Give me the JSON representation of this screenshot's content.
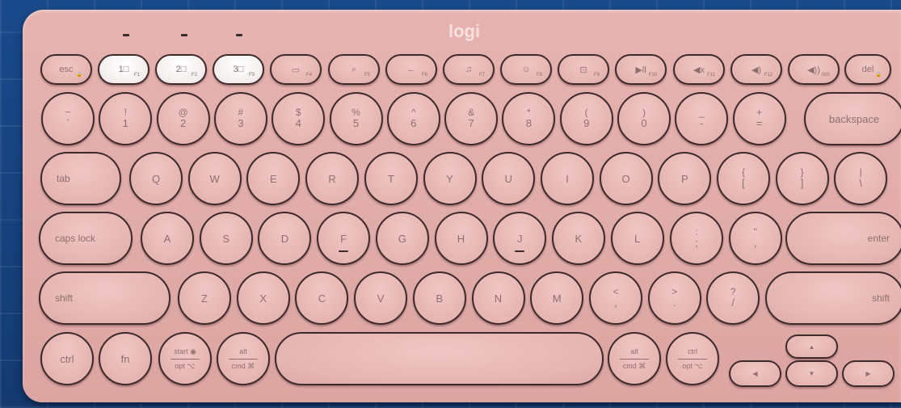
{
  "brand": "logi",
  "colors": {
    "keyboard_body": "#e2aeab",
    "key_face": "#ecbdb9",
    "key_border": "#3d2a2b",
    "background": "#17407a"
  },
  "fn_row": [
    {
      "name": "esc-key",
      "label": "esc",
      "sub": "🔒",
      "light": false
    },
    {
      "name": "channel-1-key",
      "label": "1□",
      "sub": "F1",
      "light": true
    },
    {
      "name": "channel-2-key",
      "label": "2□",
      "sub": "F2",
      "light": true
    },
    {
      "name": "channel-3-key",
      "label": "3□",
      "sub": "F3",
      "light": true
    },
    {
      "name": "app-switch-key",
      "label": "▭",
      "sub": "F4",
      "light": false
    },
    {
      "name": "search-key",
      "label": "⌕",
      "sub": "F5",
      "light": false
    },
    {
      "name": "back-key",
      "label": "←",
      "sub": "F6",
      "light": false
    },
    {
      "name": "dictation-key",
      "label": "♫",
      "sub": "F7",
      "light": false
    },
    {
      "name": "emoji-key",
      "label": "☺",
      "sub": "F8",
      "light": false
    },
    {
      "name": "screenshot-key",
      "label": "⊡",
      "sub": "F9",
      "light": false
    },
    {
      "name": "play-pause-key",
      "label": "▶ll",
      "sub": "F10",
      "light": false
    },
    {
      "name": "mute-key",
      "label": "◀x",
      "sub": "F11",
      "light": false
    },
    {
      "name": "volume-down-key",
      "label": "◀)",
      "sub": "F12",
      "light": false
    },
    {
      "name": "volume-up-key",
      "label": "◀))",
      "sub": "INS",
      "light": false
    },
    {
      "name": "del-key",
      "label": "del",
      "sub": "🔒",
      "light": false
    }
  ],
  "num_row": [
    {
      "top": "~",
      "bottom": "`"
    },
    {
      "top": "!",
      "bottom": "1"
    },
    {
      "top": "@",
      "bottom": "2"
    },
    {
      "top": "#",
      "bottom": "3"
    },
    {
      "top": "$",
      "bottom": "4"
    },
    {
      "top": "%",
      "bottom": "5"
    },
    {
      "top": "^",
      "bottom": "6"
    },
    {
      "top": "&",
      "bottom": "7"
    },
    {
      "top": "*",
      "bottom": "8"
    },
    {
      "top": "(",
      "bottom": "9"
    },
    {
      "top": ")",
      "bottom": "0"
    },
    {
      "top": "_",
      "bottom": "-"
    },
    {
      "top": "+",
      "bottom": "="
    }
  ],
  "backspace": "backspace",
  "tab": "tab",
  "q_row": [
    "Q",
    "W",
    "E",
    "R",
    "T",
    "Y",
    "U",
    "I",
    "O",
    "P"
  ],
  "q_row_extra": [
    {
      "top": "{",
      "bottom": "["
    },
    {
      "top": "}",
      "bottom": "]"
    },
    {
      "top": "|",
      "bottom": "\\"
    }
  ],
  "caps_lock": "caps lock",
  "a_row": [
    "A",
    "S",
    "D",
    "F",
    "G",
    "H",
    "J",
    "K",
    "L"
  ],
  "a_row_extra": [
    {
      "top": ":",
      "bottom": ";"
    },
    {
      "top": "\"",
      "bottom": ","
    }
  ],
  "enter": "enter",
  "shift_left": "shift",
  "z_row": [
    "Z",
    "X",
    "C",
    "V",
    "B",
    "N",
    "M"
  ],
  "z_row_extra": [
    {
      "top": "<",
      "bottom": ","
    },
    {
      "top": ">",
      "bottom": "."
    },
    {
      "top": "?",
      "bottom": "/"
    }
  ],
  "shift_right": "shift",
  "bottom_row": {
    "ctrl": "ctrl",
    "fn": "fn",
    "start_opt": {
      "top": "start ◉",
      "bottom": "opt ⌥"
    },
    "alt_cmd_left": {
      "top": "alt",
      "bottom": "cmd ⌘"
    },
    "alt_cmd_right": {
      "top": "alt",
      "bottom": "cmd ⌘"
    },
    "ctrl_opt": {
      "top": "ctrl",
      "bottom": "opt ⌥"
    },
    "arrow_up": "▲",
    "arrow_left": "◀",
    "arrow_down": "▼",
    "arrow_right": "▶"
  }
}
